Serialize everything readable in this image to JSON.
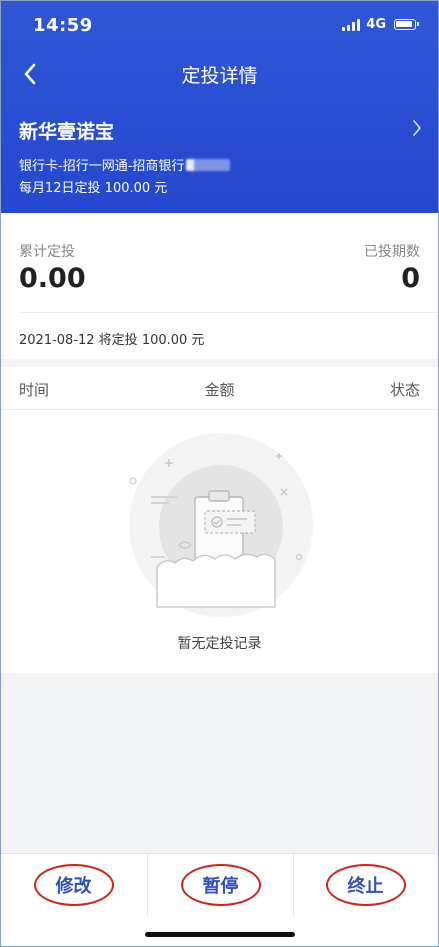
{
  "status_bar": {
    "time": "14:59",
    "network": "4G",
    "signal_icon": "cellular-signal-icon",
    "battery_icon": "battery-icon"
  },
  "nav": {
    "title": "定投详情",
    "back_icon": "chevron-left-icon"
  },
  "fund": {
    "name": "新华壹诺宝",
    "chevron_icon": "chevron-right-icon",
    "bank_account": "银行卡-招行一网通-招商银行",
    "plan": "每月12日定投 100.00 元"
  },
  "summary": {
    "total_label": "累计定投",
    "total_value": "0.00",
    "periods_label": "已投期数",
    "periods_value": "0",
    "next_investment": "2021-08-12 将定投 100.00 元"
  },
  "records": {
    "columns": [
      "时间",
      "金额",
      "状态"
    ],
    "rows": [],
    "empty_text": "暂无定投记录",
    "empty_icon": "empty-clipboard-icon"
  },
  "actions": {
    "modify": "修改",
    "pause": "暂停",
    "terminate": "终止"
  },
  "colors": {
    "header_bg": "#2f56d8",
    "action_text": "#2f4fbf",
    "annotation_circle": "#d02418"
  }
}
